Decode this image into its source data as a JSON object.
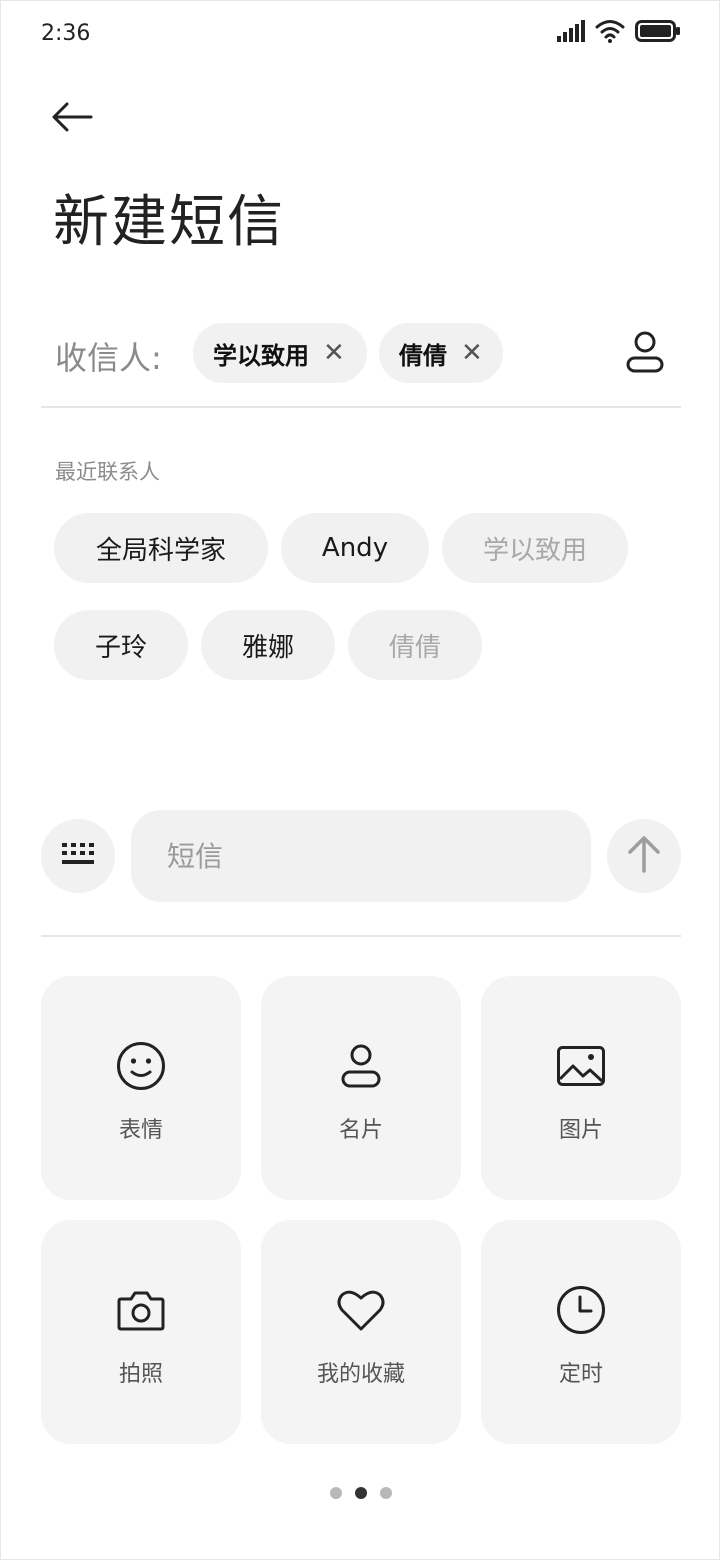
{
  "status_bar": {
    "time": "2:36",
    "icons": [
      "signal-icon",
      "wifi-icon",
      "battery-icon"
    ]
  },
  "header": {
    "back_icon": "arrow-left-icon",
    "title": "新建短信"
  },
  "recipients": {
    "label": "收信人:",
    "chips": [
      {
        "name": "学以致用",
        "remove": "✕"
      },
      {
        "name": "倩倩",
        "remove": "✕"
      }
    ],
    "picker_icon": "person-icon"
  },
  "recent": {
    "label": "最近联系人",
    "contacts": [
      {
        "name": "全局科学家",
        "selected": false
      },
      {
        "name": "Andy",
        "selected": false
      },
      {
        "name": "学以致用",
        "selected": true
      },
      {
        "name": "子玲",
        "selected": false
      },
      {
        "name": "雅娜",
        "selected": false
      },
      {
        "name": "倩倩",
        "selected": true
      }
    ]
  },
  "compose": {
    "keyboard_icon": "keyboard-icon",
    "placeholder": "短信",
    "value": "",
    "send_icon": "arrow-up-icon"
  },
  "attachments": [
    {
      "label": "表情",
      "icon": "smiley-icon"
    },
    {
      "label": "名片",
      "icon": "contact-card-icon"
    },
    {
      "label": "图片",
      "icon": "image-icon"
    },
    {
      "label": "拍照",
      "icon": "camera-icon"
    },
    {
      "label": "我的收藏",
      "icon": "heart-icon"
    },
    {
      "label": "定时",
      "icon": "clock-icon"
    }
  ],
  "pager": {
    "pages": 3,
    "current": 2
  },
  "colors": {
    "chip_bg": "#f1f1f1",
    "tile_bg": "#f4f4f4",
    "muted_text": "#8a8a8a",
    "disabled_text": "#a8a8a8"
  }
}
